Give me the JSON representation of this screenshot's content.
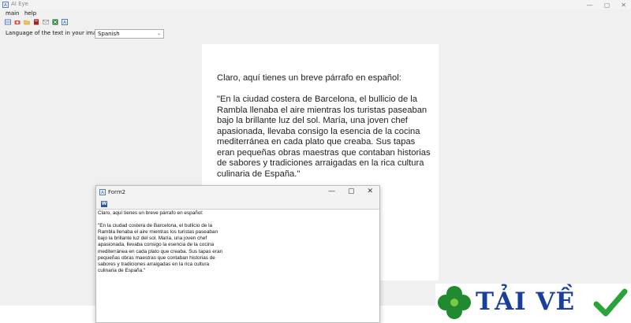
{
  "app": {
    "title": "AI Eye",
    "window_controls": {
      "minimize": "—",
      "maximize": "▢",
      "close": "✕"
    }
  },
  "menu": {
    "items": [
      "main",
      "help"
    ]
  },
  "toolbar": {
    "icons": [
      "scan-icon",
      "camera-icon",
      "folder-icon",
      "pdf-icon",
      "mail-icon",
      "excel-icon",
      "text-icon"
    ]
  },
  "language": {
    "label": "Language of the text in your image:",
    "selected": "Spanish"
  },
  "document": {
    "text": "Claro, aquí tienes un breve párrafo en español:\n\n\"En la ciudad costera de Barcelona, el bullicio de la Rambla llenaba el aire mientras los turistas paseaban bajo la brillante luz del sol. María, una joven chef apasionada, llevaba consigo la esencia de la cocina mediterránea en cada plato que creaba. Sus tapas eran pequeñas obras maestras que contaban historias de sabores y tradiciones arraigadas en la rica cultura culinaria de España.\""
  },
  "form2": {
    "title": "Form2",
    "word_icon_letter": "W",
    "text": "Claro, aquí tienes un breve párrafo en español:\n\n\"En la ciudad costera de Barcelona, el bullicio de la\nRambla llenaba el aire mientras los turistas paseaban\nbajo la brillante luz del sol. María, una joven chef\napasionada, llevaba consigo la esencia de la cocina\nmediterránea en cada plato que creaba. Sus tapas eran\npequeñas obras maestras que contaban historias de\nsabores y tradiciones arraigadas en la rica cultura\nculinaria de España.\""
  },
  "watermark": {
    "text": "TẢI VỀ",
    "colors": {
      "text": "#1a3f9b",
      "clover": "#1f8a2e",
      "check": "#2aa33a"
    }
  }
}
